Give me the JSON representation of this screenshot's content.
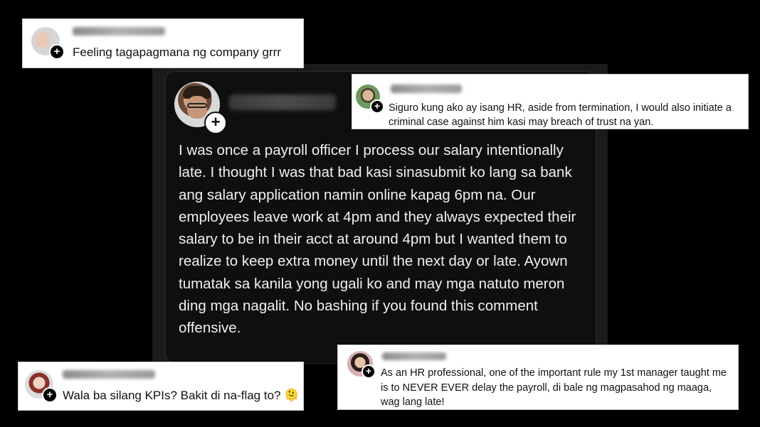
{
  "post": {
    "body": "I was once a payroll officer I process our salary intentionally late. I thought I was that bad kasi sinasubmit ko lang sa bank ang salary application namin online kapag 6pm na. Our employees leave work at 4pm and they always expected their salary to be in their acct at around 4pm but I wanted them to realize to keep extra money until the next day or late. Ayown tumatak sa kanila yong ugali ko and may mga natuto meron ding mga nagalit. No bashing if you found this comment offensive.",
    "follow_icon": "+"
  },
  "comments": [
    {
      "text": "Feeling tagapagmana ng company grrr",
      "follow_icon": "+"
    },
    {
      "text": "Siguro kung ako ay isang HR, aside from termination, I would also initiate a criminal case against him kasi may breach of trust na yan.",
      "follow_icon": "+"
    },
    {
      "text": "Wala ba silang KPIs? Bakit di na-flag to? 🫠",
      "follow_icon": "+"
    },
    {
      "text": "As an HR professional, one of the important rule my 1st manager taught me is to NEVER EVER delay the payroll, di bale ng magpasahod ng maaga, wag lang late!",
      "follow_icon": "+"
    }
  ]
}
